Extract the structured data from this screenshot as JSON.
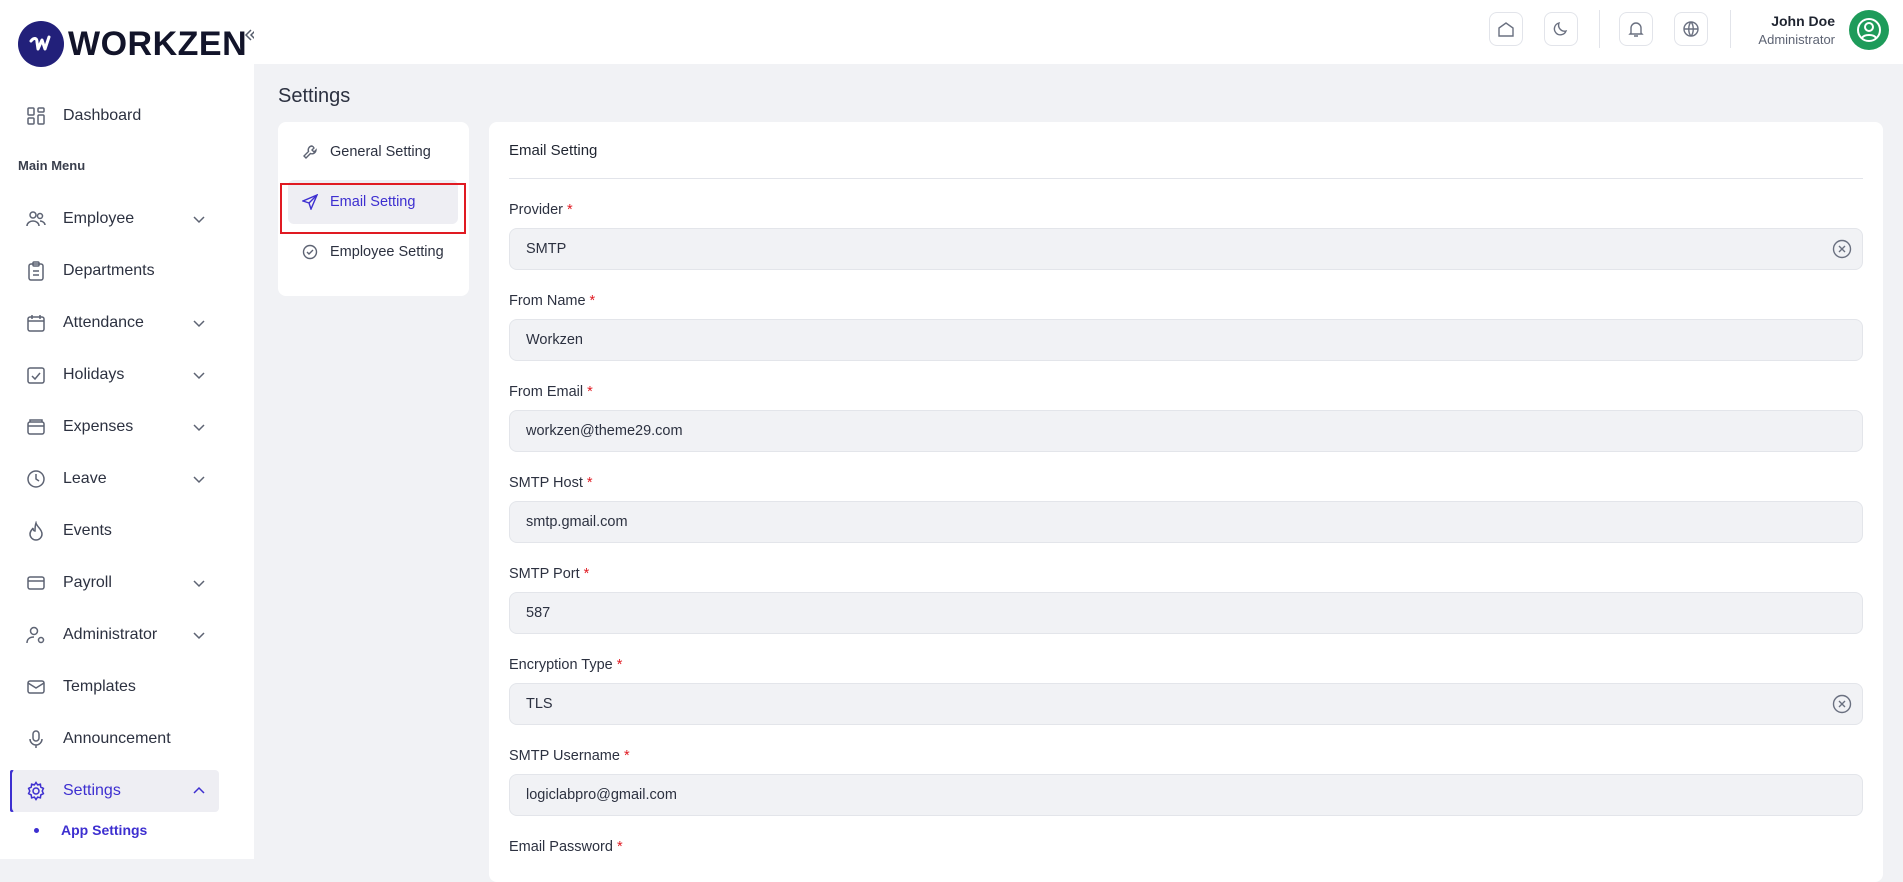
{
  "brand": {
    "name": "WORKZEN",
    "accent": "#3d2fd0",
    "logo_bg": "#22207a"
  },
  "sidebar": {
    "dashboard": {
      "label": "Dashboard",
      "icon": "dashboard-grid-icon"
    },
    "section_label": "Main Menu",
    "items": [
      {
        "label": "Employee",
        "icon": "users-icon",
        "has_chevron": true
      },
      {
        "label": "Departments",
        "icon": "clipboard-icon",
        "has_chevron": false
      },
      {
        "label": "Attendance",
        "icon": "calendar-icon",
        "has_chevron": true
      },
      {
        "label": "Holidays",
        "icon": "calendar-check-icon",
        "has_chevron": true
      },
      {
        "label": "Expenses",
        "icon": "wallet-icon",
        "has_chevron": true
      },
      {
        "label": "Leave",
        "icon": "clock-icon",
        "has_chevron": true
      },
      {
        "label": "Events",
        "icon": "flame-icon",
        "has_chevron": false
      },
      {
        "label": "Payroll",
        "icon": "credit-card-icon",
        "has_chevron": true
      },
      {
        "label": "Administrator",
        "icon": "user-cog-icon",
        "has_chevron": true
      },
      {
        "label": "Templates",
        "icon": "mail-icon",
        "has_chevron": false
      },
      {
        "label": "Announcement",
        "icon": "microphone-icon",
        "has_chevron": false
      },
      {
        "label": "Settings",
        "icon": "gear-icon",
        "has_chevron": true,
        "active": true
      }
    ],
    "sub_item": "App Settings"
  },
  "topbar": {
    "icons": [
      "home-icon",
      "moon-icon",
      "bell-icon",
      "globe-icon"
    ],
    "user_name": "John Doe",
    "user_role": "Administrator"
  },
  "page": {
    "title": "Settings"
  },
  "settings_nav": [
    {
      "label": "General Setting",
      "icon": "wrench-icon"
    },
    {
      "label": "Email Setting",
      "icon": "send-icon",
      "active": true
    },
    {
      "label": "Employee Setting",
      "icon": "check-circle-icon"
    }
  ],
  "form": {
    "title": "Email Setting",
    "fields": [
      {
        "label": "Provider",
        "value": "SMTP",
        "clearable": true
      },
      {
        "label": "From Name",
        "value": "Workzen",
        "clearable": false
      },
      {
        "label": "From Email",
        "value": "workzen@theme29.com",
        "clearable": false
      },
      {
        "label": "SMTP Host",
        "value": "smtp.gmail.com",
        "clearable": false
      },
      {
        "label": "SMTP Port",
        "value": "587",
        "clearable": false
      },
      {
        "label": "Encryption Type",
        "value": "TLS",
        "clearable": true
      },
      {
        "label": "SMTP Username",
        "value": "logiclabpro@gmail.com",
        "clearable": false
      },
      {
        "label": "Email Password",
        "value": "",
        "clearable": false
      }
    ],
    "required_marker": "*"
  }
}
